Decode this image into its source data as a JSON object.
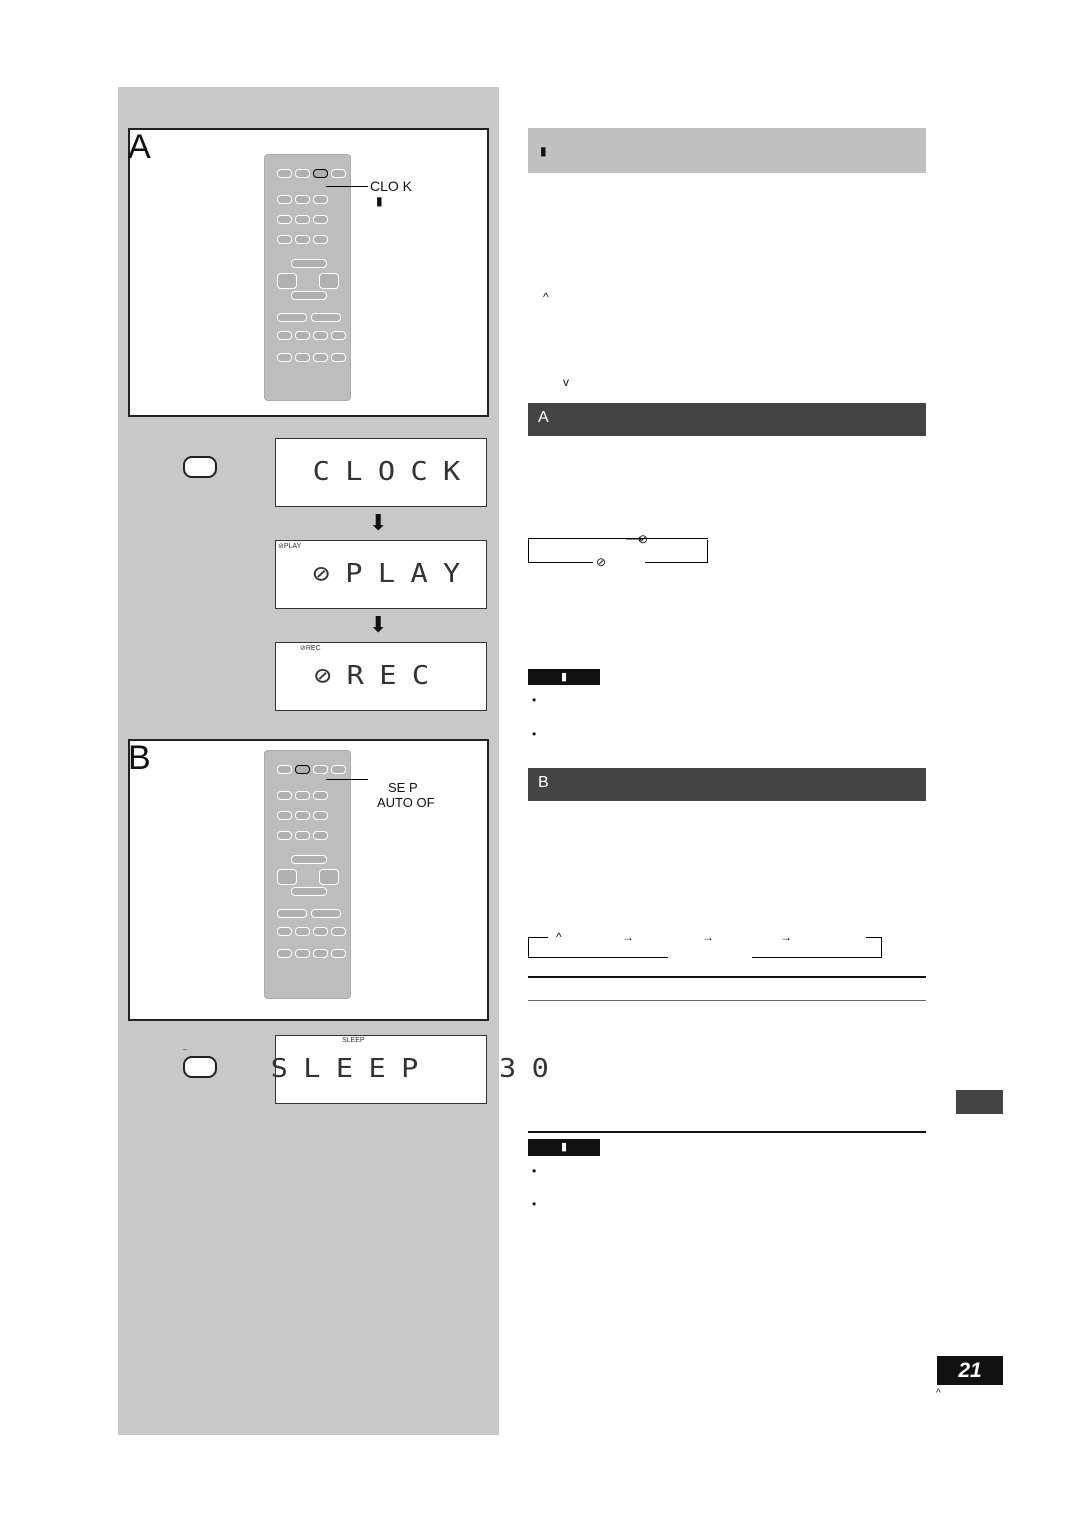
{
  "left": {
    "section_a": {
      "letter": "A",
      "callout_line1": "CLO  K",
      "callout_line2": "▮",
      "displays": [
        {
          "indicator": "",
          "text": "CLOCK"
        },
        {
          "indicator": "⊘PLAY",
          "text": "⊘PLAY"
        },
        {
          "indicator": "⊘REC",
          "text": "⊘REC"
        }
      ]
    },
    "section_b": {
      "letter": "B",
      "callout_line1": "SE   P",
      "callout_line2": "AUTO OF",
      "display": {
        "indicator": "SLEEP",
        "text": "SLEEP  30"
      },
      "hand_label": "–"
    }
  },
  "right": {
    "top_header": "▮",
    "section_a_header": "A",
    "section_b_header": "B",
    "note_label": "▮",
    "bullets": [
      "•",
      "•"
    ],
    "arrows_a": [
      "⟶",
      "⊘",
      "⊘"
    ],
    "arrows_b": [
      "^",
      "→",
      "→",
      "→"
    ],
    "carets": [
      "^",
      "v"
    ]
  },
  "page_number": "21",
  "footer_caret": "^"
}
